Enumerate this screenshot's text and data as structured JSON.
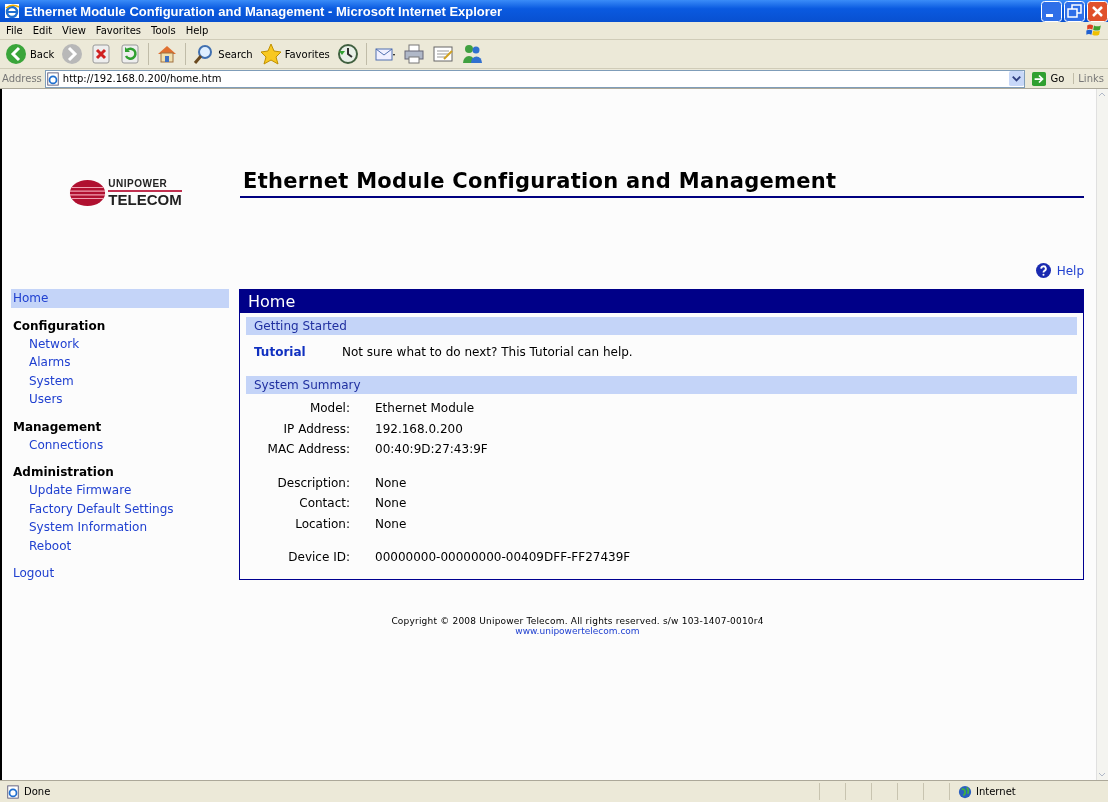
{
  "window": {
    "title": "Ethernet Module Configuration and Management - Microsoft Internet Explorer"
  },
  "menu_bar": [
    "File",
    "Edit",
    "View",
    "Favorites",
    "Tools",
    "Help"
  ],
  "toolbar": [
    {
      "kind": "back",
      "label": "Back"
    },
    {
      "kind": "forward"
    },
    {
      "kind": "stop"
    },
    {
      "kind": "refresh"
    },
    {
      "kind": "home"
    },
    {
      "kind": "search",
      "label": "Search"
    },
    {
      "kind": "favorites",
      "label": "Favorites"
    },
    {
      "kind": "history"
    },
    {
      "kind": "mail"
    },
    {
      "kind": "print"
    },
    {
      "kind": "edit"
    },
    {
      "kind": "messenger"
    }
  ],
  "address_bar": {
    "label": "Address",
    "value": "http://192.168.0.200/home.htm",
    "go": "Go",
    "links": "Links"
  },
  "page": {
    "logo": {
      "line_1": "UNIPOWER",
      "line_2": "TELECOM"
    },
    "heading": "Ethernet Module Configuration and Management",
    "help": "Help",
    "sidebar": {
      "items": [
        {
          "kind": "link",
          "label": "Home",
          "selected": true
        },
        {
          "kind": "group",
          "label": "Configuration",
          "children": [
            {
              "label": "Network",
              "selected": false
            },
            {
              "label": "Alarms",
              "selected": false
            },
            {
              "label": "System",
              "selected": false
            },
            {
              "label": "Users",
              "selected": false
            }
          ]
        },
        {
          "kind": "group",
          "label": "Management",
          "children": [
            {
              "label": "Connections",
              "selected": false
            }
          ]
        },
        {
          "kind": "group",
          "label": "Administration",
          "children": [
            {
              "label": "Update Firmware",
              "selected": false
            },
            {
              "label": "Factory Default Settings",
              "selected": false
            },
            {
              "label": "System Information",
              "selected": false
            },
            {
              "label": "Reboot",
              "selected": false
            }
          ]
        },
        {
          "kind": "link",
          "label": "Logout",
          "selected": false
        }
      ]
    },
    "panel": {
      "title": "Home",
      "sections": [
        {
          "kind": "links",
          "title": "Getting Started",
          "rows": [
            {
              "link": "Tutorial",
              "text": "Not sure what to do next? This Tutorial can help."
            }
          ]
        },
        {
          "kind": "fields",
          "title": "System Summary",
          "groups": [
            [
              {
                "label": "Model:",
                "value": "Ethernet Module"
              },
              {
                "label": "IP Address:",
                "value": "192.168.0.200"
              },
              {
                "label": "MAC Address:",
                "value": "00:40:9D:27:43:9F"
              }
            ],
            [
              {
                "label": "Description:",
                "value": "None"
              },
              {
                "label": "Contact:",
                "value": "None"
              },
              {
                "label": "Location:",
                "value": "None"
              }
            ],
            [
              {
                "label": "Device ID:",
                "value": "00000000-00000000-00409DFF-FF27439F"
              }
            ]
          ]
        }
      ]
    },
    "footer": {
      "copyright": "Copyright © 2008 Unipower Telecom. All rights reserved. s/w 103-1407-0010r4",
      "link": "www.unipowertelecom.com"
    }
  },
  "status_bar": {
    "text": "Done",
    "zone": "Internet"
  }
}
